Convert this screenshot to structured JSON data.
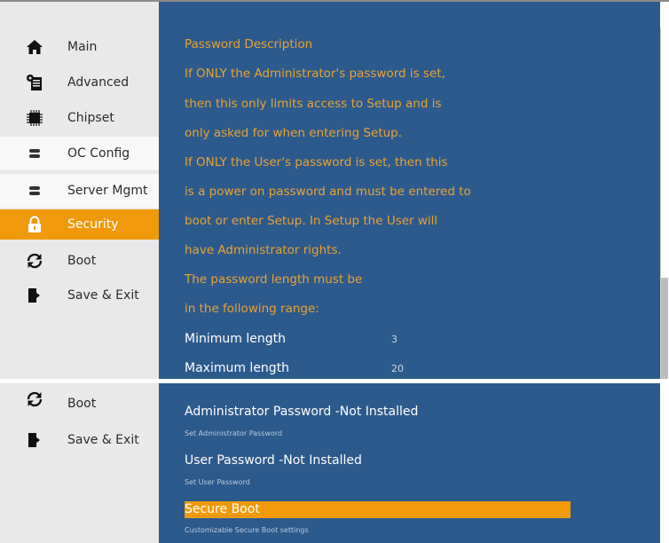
{
  "sidebar": {
    "items": [
      {
        "label": "Main",
        "icon": "home-icon"
      },
      {
        "label": "Advanced",
        "icon": "gear-doc-icon"
      },
      {
        "label": "Chipset",
        "icon": "chip-icon"
      },
      {
        "label": "OC Config",
        "icon": "toggle-icon"
      },
      {
        "label": "Server Mgmt",
        "icon": "toggle-icon"
      },
      {
        "label": "Security",
        "icon": "lock-icon",
        "active": true
      },
      {
        "label": "Boot",
        "icon": "refresh-icon"
      },
      {
        "label": "Save & Exit",
        "icon": "exit-icon"
      }
    ]
  },
  "password_description": {
    "lines": [
      "Password Description",
      "If ONLY the Administrator's password is set,",
      "then this only limits access to Setup and is",
      "only asked for when entering Setup.",
      "If ONLY the User's password is set, then this",
      "is a power on password and must be entered to",
      "boot or enter Setup. In Setup the User will",
      "have Administrator rights.",
      "The password length must be",
      "in the following range:"
    ],
    "minimum_label": "Minimum length",
    "minimum_value": "3",
    "maximum_label": "Maximum length",
    "maximum_value": "20"
  },
  "bottom_sidebar": {
    "boot_label": "Boot",
    "save_exit_label": "Save & Exit"
  },
  "options": [
    {
      "title": "Administrator Password -Not Installed",
      "help": "Set Administrator Password"
    },
    {
      "title": "User Password -Not Installed",
      "help": "Set User Password"
    },
    {
      "title": "Secure Boot",
      "help": "Customizable Secure Boot settings",
      "selected": true
    }
  ],
  "colors": {
    "accent": "#f09a0b",
    "main_bg": "#2d5a8c",
    "description_text": "#e7a233",
    "sidebar_bg": "#e9e9e9"
  }
}
